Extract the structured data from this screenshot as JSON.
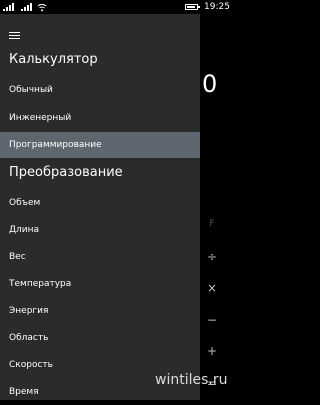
{
  "status": {
    "time": "19:25"
  },
  "calculator": {
    "display_value": "0",
    "ops": [
      "F",
      "÷",
      "×",
      "−",
      "+",
      "="
    ]
  },
  "menu": {
    "section_calculator": "Калькулятор",
    "calculator_items": [
      "Обычный",
      "Инженерный",
      "Программирование"
    ],
    "selected_item": "Программирование",
    "section_conversion": "Преобразование",
    "conversion_items": [
      "Объем",
      "Длина",
      "Вес",
      "Температура",
      "Энергия",
      "Область",
      "Скорость",
      "Время"
    ]
  },
  "watermark": "wintiles.ru",
  "icons": {
    "menu": "hamburger-icon",
    "signal": "signal-icon",
    "wifi": "wifi-icon",
    "battery": "battery-icon"
  }
}
